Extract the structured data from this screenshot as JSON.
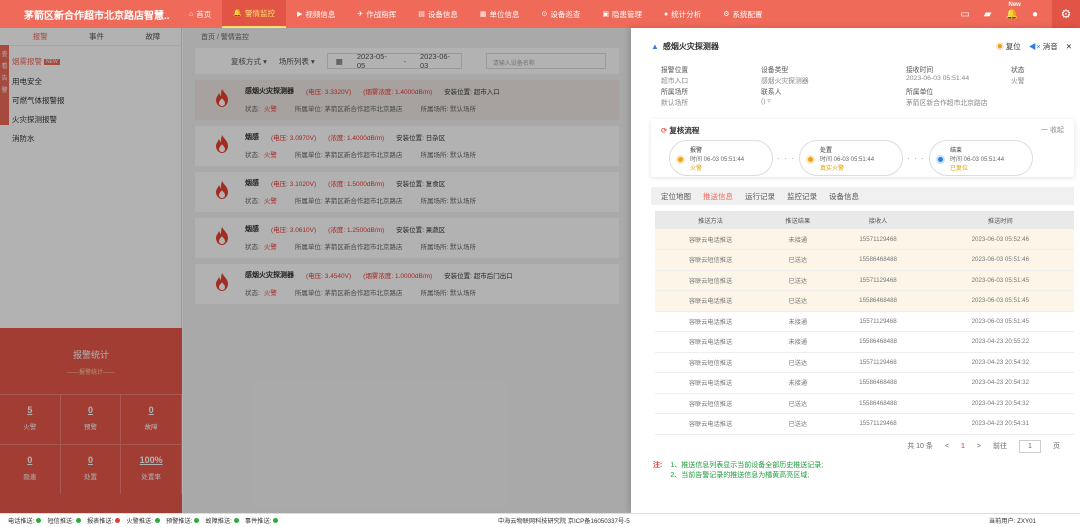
{
  "app": {
    "title": "茅箭区新合作超市北京路店智慧..."
  },
  "nav": [
    {
      "icon": "⌂",
      "label": "首页"
    },
    {
      "icon": "🔔",
      "label": "警情监控"
    },
    {
      "icon": "▶",
      "label": "视频信息"
    },
    {
      "icon": "✈",
      "label": "作战指挥"
    },
    {
      "icon": "▤",
      "label": "设备信息"
    },
    {
      "icon": "▦",
      "label": "单位信息"
    },
    {
      "icon": "⊙",
      "label": "设备巡查"
    },
    {
      "icon": "▣",
      "label": "隐患管理"
    },
    {
      "icon": "●",
      "label": "统计分析"
    },
    {
      "icon": "⚙",
      "label": "系统配置"
    }
  ],
  "top_right": {
    "new_badge": "New"
  },
  "left_tab": {
    "text": "查看告警"
  },
  "sidebar": {
    "tabs": [
      "报警",
      "事件",
      "故障"
    ],
    "items": [
      "烟雾报警",
      "用电安全",
      "可燃气体报警报",
      "火灾探测报警",
      "消防水"
    ],
    "new_tag": "NEW"
  },
  "stats": {
    "title": "报警统计",
    "subtitle": "——报警统计——",
    "items": [
      {
        "value": "5",
        "label": "火警"
      },
      {
        "value": "0",
        "label": "预警"
      },
      {
        "value": "0",
        "label": "故障"
      },
      {
        "value": "0",
        "label": "隐患"
      },
      {
        "value": "0",
        "label": "处置"
      },
      {
        "value": "100%",
        "label": "处置率"
      }
    ]
  },
  "main": {
    "breadcrumb": "首页 / 警情监控",
    "filter": {
      "sort": "复核方式 ▾",
      "place": "场所列表 ▾",
      "date_start": "2023-05-05",
      "date_sep": "-",
      "date_end": "2023-06-03",
      "search_placeholder": "请输入设备名称"
    },
    "events": [
      {
        "name": "感烟火灾探测器",
        "voltage": "(电压: 3.3320V)",
        "density": "(烟雾浓度: 1.4000dB/m)",
        "location": "安装位置: 超市入口",
        "status": "火警",
        "unit": "所属单位: 茅箭区新合作超市北京路店",
        "place": "所属场所: 默认场所"
      },
      {
        "name": "烟感",
        "voltage": "(电压: 3.0970V)",
        "density": "(浓度: 1.4000dB/m)",
        "location": "安装位置: 日杂区",
        "status": "火警",
        "unit": "所属单位: 茅箭区新合作超市北京路店",
        "place": "所属场所: 默认场所"
      },
      {
        "name": "烟感",
        "voltage": "(电压: 3.1020V)",
        "density": "(浓度: 1.5000dB/m)",
        "location": "安装位置: 复食区",
        "status": "火警",
        "unit": "所属单位: 茅箭区新合作超市北京路店",
        "place": "所属场所: 默认场所"
      },
      {
        "name": "烟感",
        "voltage": "(电压: 3.0610V)",
        "density": "(浓度: 1.2500dB/m)",
        "location": "安装位置: 果蔬区",
        "status": "火警",
        "unit": "所属单位: 茅箭区新合作超市北京路店",
        "place": "所属场所: 默认场所"
      },
      {
        "name": "感烟火灾探测器",
        "voltage": "(电压: 3.4540V)",
        "density": "(烟雾浓度: 1.0000dB/m)",
        "location": "安装位置: 超市后门出口",
        "status": "火警",
        "unit": "所属单位: 茅箭区新合作超市北京路店",
        "place": "所属场所: 默认场所"
      }
    ],
    "status_label": "状态:"
  },
  "panel": {
    "title": "感烟火灾探测器",
    "actions": {
      "reset": "复位",
      "mute": "消音",
      "close": "✕"
    },
    "info": [
      {
        "label": "报警位置",
        "value": "超市入口"
      },
      {
        "label": "设备类型",
        "value": "感烟火灾探测器"
      },
      {
        "label": "接收时间",
        "value": "2023-06-03 05:51:44"
      },
      {
        "label": "状态",
        "value": "火警"
      },
      {
        "label": "所属场所",
        "value": "默认场所"
      },
      {
        "label": "联系人",
        "value": "() ▿"
      },
      {
        "label": "所属单位",
        "value": "茅箭区新合作超市北京路店"
      },
      {
        "label": "",
        "value": ""
      }
    ],
    "flow": {
      "title": "复核流程",
      "collapse": "一 收起",
      "steps": [
        {
          "name": "报警",
          "time": "时间 06-03 05:51:44",
          "status": "火警",
          "color": "#f0a020"
        },
        {
          "name": "处置",
          "time": "时间 06-03 05:51:44",
          "status": "真实火警",
          "color": "#f0a020"
        },
        {
          "name": "结束",
          "time": "时间 06-03 05:51:44",
          "status": "已复位",
          "color": "#2f7fe8"
        }
      ],
      "sep": "· · ·"
    },
    "tabs": [
      "定位地图",
      "推送信息",
      "运行记录",
      "监控记录",
      "设备信息"
    ],
    "table": {
      "headers": [
        "推送方法",
        "推送结果",
        "接收人",
        "推送时间"
      ],
      "rows": [
        [
          "容联云电话推送",
          "未接通",
          "15571129468",
          "2023-06-03 05:52:46"
        ],
        [
          "容联云短信推送",
          "已送达",
          "15586468488",
          "2023-06-03 05:51:46"
        ],
        [
          "容联云短信推送",
          "已送达",
          "15571129468",
          "2023-06-03 05:51:45"
        ],
        [
          "容联云电话推送",
          "已送达",
          "15586468488",
          "2023-06-03 05:51:45"
        ],
        [
          "容联云电话推送",
          "未接通",
          "15571129468",
          "2023-06-03 05:51:45"
        ],
        [
          "容联云电话推送",
          "未接通",
          "15586468488",
          "2023-04-23 20:55:22"
        ],
        [
          "容联云短信推送",
          "已送达",
          "15571129468",
          "2023-04-23 20:54:32"
        ],
        [
          "容联云电话推送",
          "未接通",
          "15586468488",
          "2023-04-23 20:54:32"
        ],
        [
          "容联云短信推送",
          "已送达",
          "15586468488",
          "2023-04-23 20:54:32"
        ],
        [
          "容联云电话推送",
          "已送达",
          "15571129468",
          "2023-04-23 20:54:31"
        ]
      ],
      "highlight_rows": 4
    },
    "pager": {
      "total": "共 10 条",
      "prev": "<",
      "page": "1",
      "next": ">",
      "goto": "前往",
      "input": "1",
      "unit": "页"
    },
    "notes": {
      "label": "注:",
      "lines": [
        "1、推送信息列表显示当前设备全部历史推送记录;",
        "2、当前告警记录的推送信息为橘黄高亮区域;"
      ]
    }
  },
  "footer": {
    "items": [
      {
        "label": "电话推送:",
        "dot": "green"
      },
      {
        "label": "短信推送:",
        "dot": "green"
      },
      {
        "label": "报表推送:",
        "dot": "red"
      },
      {
        "label": "火警推送:",
        "dot": "green"
      },
      {
        "label": "预警推送:",
        "dot": "green"
      },
      {
        "label": "故障推送:",
        "dot": "green"
      },
      {
        "label": "事件推送:",
        "dot": "green"
      }
    ],
    "center": "中海云物联网科技研究院 京ICP备16050337号-5",
    "user": "当前用户: ZXY01"
  }
}
